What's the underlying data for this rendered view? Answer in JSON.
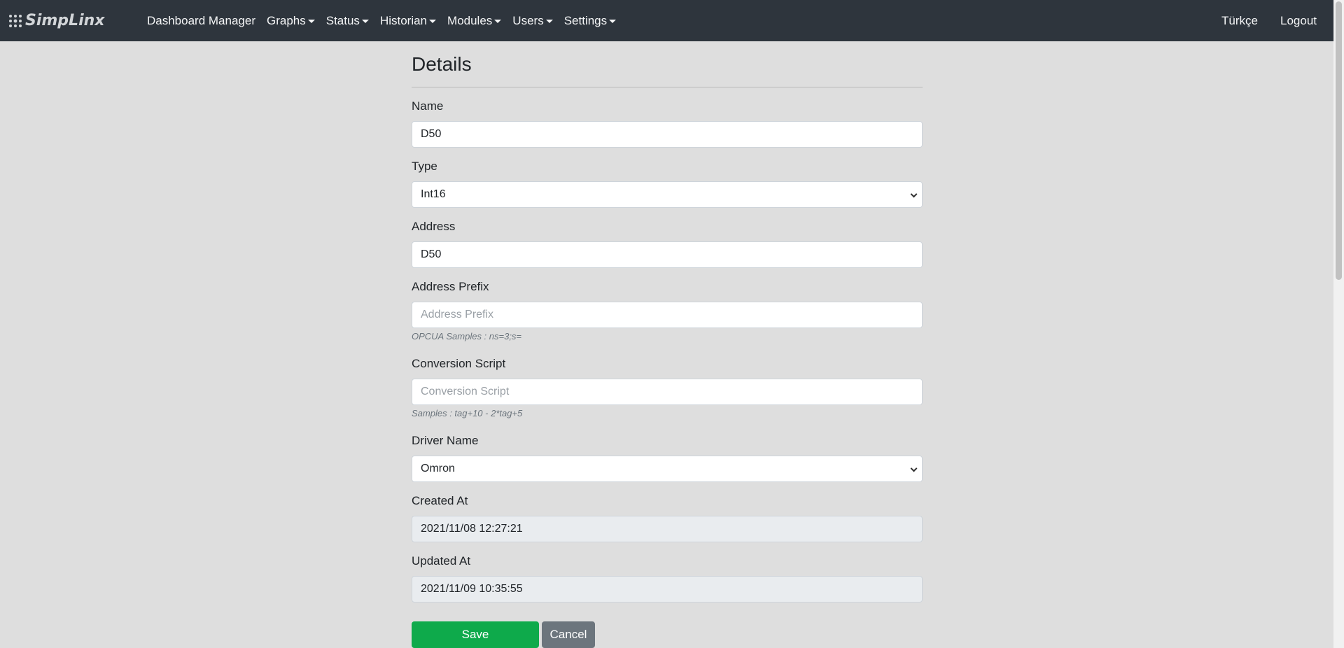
{
  "brand": {
    "name": "SimpLinx"
  },
  "navbar": {
    "items": [
      {
        "label": "Dashboard Manager",
        "dropdown": false
      },
      {
        "label": "Graphs",
        "dropdown": true
      },
      {
        "label": "Status",
        "dropdown": true
      },
      {
        "label": "Historian",
        "dropdown": true
      },
      {
        "label": "Modules",
        "dropdown": true
      },
      {
        "label": "Users",
        "dropdown": true
      },
      {
        "label": "Settings",
        "dropdown": true
      }
    ],
    "language": "Türkçe",
    "logout": "Logout"
  },
  "form": {
    "title": "Details",
    "name": {
      "label": "Name",
      "value": "D50"
    },
    "type": {
      "label": "Type",
      "value": "Int16"
    },
    "address": {
      "label": "Address",
      "value": "D50"
    },
    "address_prefix": {
      "label": "Address Prefix",
      "value": "",
      "placeholder": "Address Prefix",
      "help": "OPCUA Samples : ns=3;s="
    },
    "conversion_script": {
      "label": "Conversion Script",
      "value": "",
      "placeholder": "Conversion Script",
      "help": "Samples : tag+10 - 2*tag+5"
    },
    "driver_name": {
      "label": "Driver Name",
      "value": "Omron"
    },
    "created_at": {
      "label": "Created At",
      "value": "2021/11/08 12:27:21"
    },
    "updated_at": {
      "label": "Updated At",
      "value": "2021/11/09 10:35:55"
    },
    "save_label": "Save",
    "cancel_label": "Cancel"
  },
  "colors": {
    "navbar_bg": "#2e353d",
    "page_bg": "#dedede",
    "save_button": "#0eaa4b",
    "cancel_button": "#6c757d"
  }
}
